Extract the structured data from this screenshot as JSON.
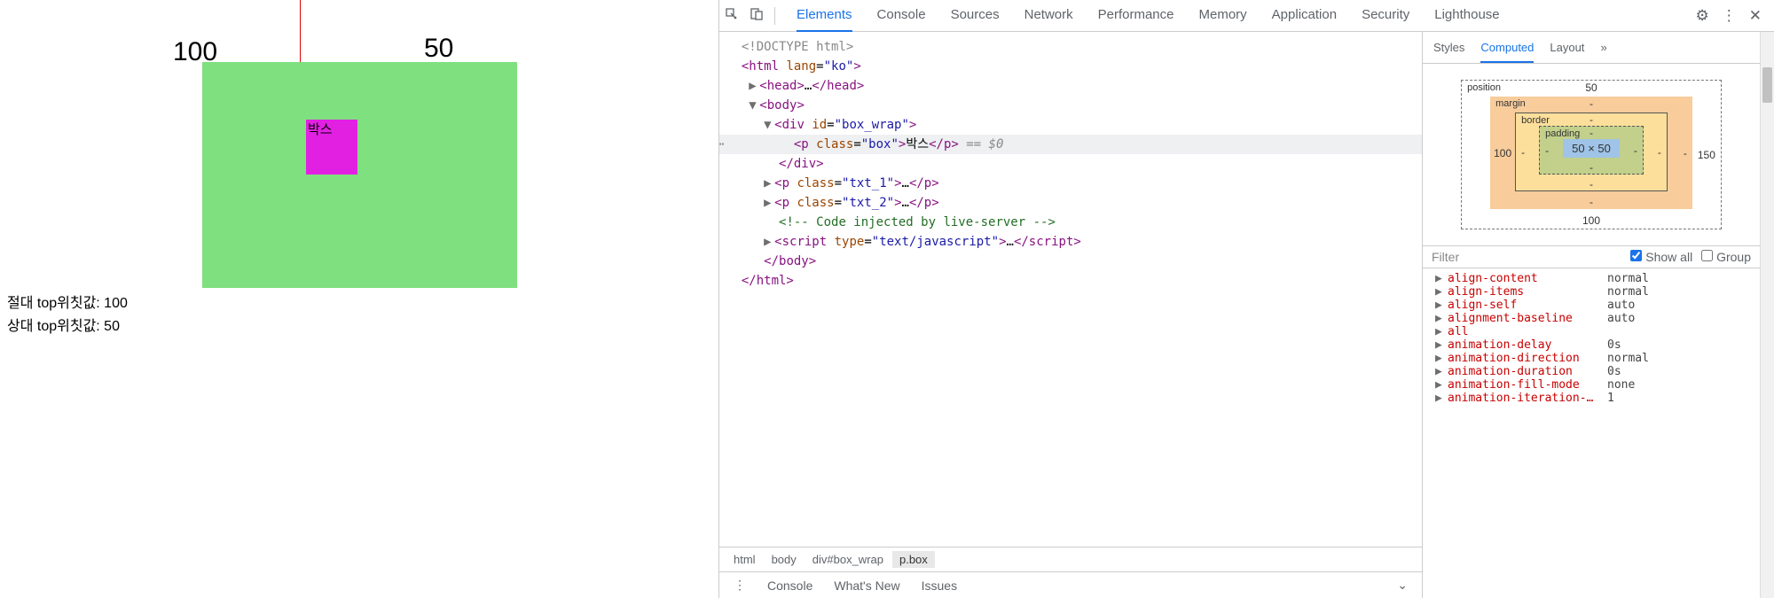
{
  "page": {
    "label100": "100",
    "label50": "50",
    "boxText": "박스",
    "txt1": "절대 top위칫값: 100",
    "txt2": "상대 top위칫값: 50"
  },
  "devtools": {
    "tabs": [
      "Elements",
      "Console",
      "Sources",
      "Network",
      "Performance",
      "Memory",
      "Application",
      "Security",
      "Lighthouse"
    ],
    "activeTab": "Elements",
    "dom": {
      "l0": "<!DOCTYPE html>",
      "l1_open": "<html lang=\"ko\">",
      "l2": "<head>…</head>",
      "l3": "<body>",
      "l4": "<div id=\"box_wrap\">",
      "l5_raw": "<p class=\"box\">박스</p>",
      "l5_hint": " == $0",
      "l6": "</div>",
      "l7": "<p class=\"txt_1\">…</p>",
      "l8": "<p class=\"txt_2\">…</p>",
      "l9": "<!-- Code injected by live-server -->",
      "l10": "<script type=\"text/javascript\">…</script>",
      "l11": "</body>",
      "l12": "</html>"
    },
    "breadcrumb": [
      "html",
      "body",
      "div#box_wrap",
      "p.box"
    ],
    "drawer": [
      "Console",
      "What's New",
      "Issues"
    ]
  },
  "styles": {
    "tabs": [
      "Styles",
      "Computed",
      "Layout"
    ],
    "activeTab": "Computed",
    "boxModel": {
      "position": {
        "label": "position",
        "t": "50",
        "r": "",
        "b": "100",
        "l": ""
      },
      "margin": {
        "label": "margin",
        "t": "-",
        "r": "-",
        "b": "-",
        "l": "100"
      },
      "border": {
        "label": "border",
        "t": "-",
        "r": "-",
        "b": "-",
        "l": "-"
      },
      "padding": {
        "label": "padding",
        "t": "-",
        "r": "-",
        "b": "-",
        "l": "-"
      },
      "content": "50 × 50",
      "outerRight": "150"
    },
    "filter": {
      "placeholder": "Filter",
      "showAll": "Show all",
      "group": "Group"
    },
    "props": [
      {
        "n": "align-content",
        "v": "normal"
      },
      {
        "n": "align-items",
        "v": "normal"
      },
      {
        "n": "align-self",
        "v": "auto"
      },
      {
        "n": "alignment-baseline",
        "v": "auto"
      },
      {
        "n": "all",
        "v": ""
      },
      {
        "n": "animation-delay",
        "v": "0s"
      },
      {
        "n": "animation-direction",
        "v": "normal"
      },
      {
        "n": "animation-duration",
        "v": "0s"
      },
      {
        "n": "animation-fill-mode",
        "v": "none"
      },
      {
        "n": "animation-iteration-…",
        "v": "1"
      }
    ]
  }
}
